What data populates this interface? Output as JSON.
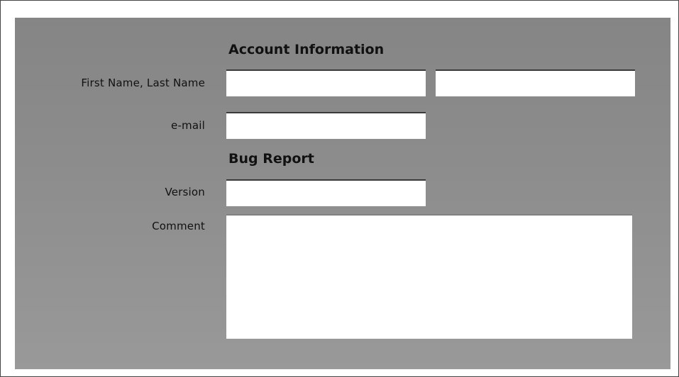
{
  "form": {
    "account_heading": "Account Information",
    "bug_heading": "Bug Report",
    "name_label": "First Name, Last Name",
    "email_label": "e-mail",
    "version_label": "Version",
    "comment_label": "Comment",
    "first_name_value": "",
    "last_name_value": "",
    "email_value": "",
    "version_value": "",
    "comment_value": ""
  }
}
